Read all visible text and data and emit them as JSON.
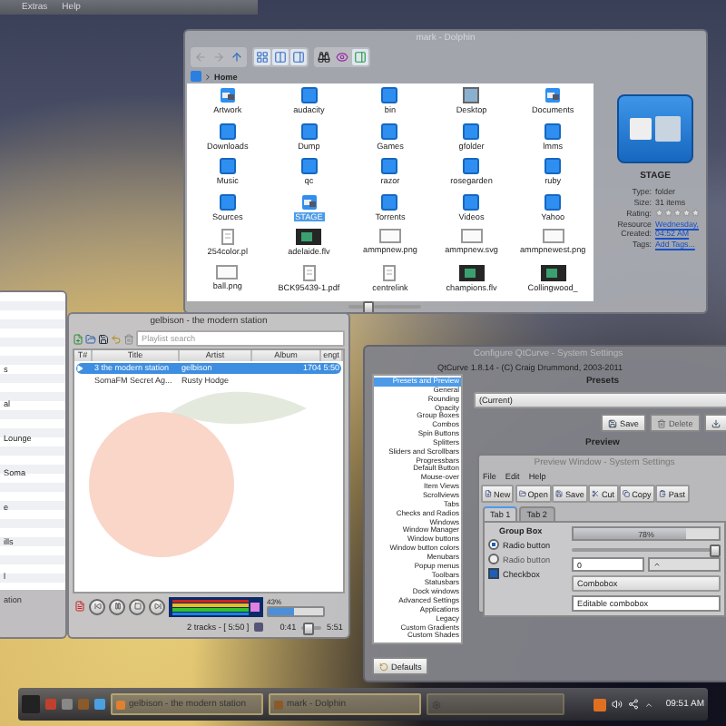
{
  "top_menu": [
    {
      "label": "Extras"
    },
    {
      "label": "Help"
    }
  ],
  "file_manager": {
    "title": "mark - Dolphin",
    "breadcrumb": "Home",
    "files": [
      {
        "name": "Artwork",
        "kind": "image",
        "selected": false
      },
      {
        "name": "audacity",
        "kind": "folder",
        "selected": false
      },
      {
        "name": "bin",
        "kind": "folder",
        "selected": false
      },
      {
        "name": "Desktop",
        "kind": "desktop",
        "selected": false
      },
      {
        "name": "Documents",
        "kind": "image",
        "selected": false
      },
      {
        "name": "Downloads",
        "kind": "folder",
        "selected": false
      },
      {
        "name": "Dump",
        "kind": "folder",
        "selected": false
      },
      {
        "name": "Games",
        "kind": "folder",
        "selected": false
      },
      {
        "name": "gfolder",
        "kind": "folder",
        "selected": false
      },
      {
        "name": "lmms",
        "kind": "folder",
        "selected": false
      },
      {
        "name": "Music",
        "kind": "folder",
        "selected": false
      },
      {
        "name": "qc",
        "kind": "folder",
        "selected": false
      },
      {
        "name": "razor",
        "kind": "folder",
        "selected": false
      },
      {
        "name": "rosegarden",
        "kind": "folder",
        "selected": false
      },
      {
        "name": "ruby",
        "kind": "folder",
        "selected": false
      },
      {
        "name": "Sources",
        "kind": "folder",
        "selected": false
      },
      {
        "name": "STAGE",
        "kind": "image",
        "selected": true
      },
      {
        "name": "Torrents",
        "kind": "folder",
        "selected": false
      },
      {
        "name": "Videos",
        "kind": "folder",
        "selected": false
      },
      {
        "name": "Yahoo",
        "kind": "folder",
        "selected": false
      },
      {
        "name": "254color.pl",
        "kind": "file",
        "selected": false
      },
      {
        "name": "adelaide.flv",
        "kind": "video",
        "selected": false
      },
      {
        "name": "ammpnew.png",
        "kind": "picture",
        "selected": false
      },
      {
        "name": "ammpnew.svg",
        "kind": "picture",
        "selected": false
      },
      {
        "name": "ammpnewest.png",
        "kind": "picture",
        "selected": false
      },
      {
        "name": "ball.png",
        "kind": "picture",
        "selected": false
      },
      {
        "name": "BCK95439-1.pdf",
        "kind": "file",
        "selected": false
      },
      {
        "name": "centrelink",
        "kind": "file",
        "selected": false
      },
      {
        "name": "champions.flv",
        "kind": "video",
        "selected": false
      },
      {
        "name": "Collingwood_",
        "kind": "video",
        "selected": false
      }
    ],
    "zoom": {
      "level": 0.25
    },
    "info": {
      "name": "STAGE",
      "stars": 0,
      "fields": [
        {
          "label": "Type:",
          "value": "folder",
          "kind": "text"
        },
        {
          "label": "Size:",
          "value": "31 items",
          "kind": "text"
        },
        {
          "label": "Rating:",
          "kind": "rating"
        },
        {
          "label": "Resource Created:",
          "value": "Wednesday, 04:52 AM",
          "kind": "link"
        },
        {
          "label": "Tags:",
          "value": "Add Tags...",
          "kind": "link"
        }
      ]
    }
  },
  "library": {
    "items": [
      "s",
      "al",
      "Lounge",
      "Soma",
      "e",
      "ills",
      "l"
    ],
    "footer": "ation"
  },
  "player": {
    "title": "gelbison - the modern station",
    "search": {
      "placeholder": "Playlist search"
    },
    "columns": [
      "T#",
      "Title",
      "Artist",
      "Album",
      "engt"
    ],
    "rows": [
      {
        "title": "3 the modern station",
        "artist": "gelbison",
        "album": "1704",
        "length": "5:50",
        "selected": true,
        "playing": true
      },
      {
        "title": "SomaFM Secret Ag...",
        "artist": "Rusty Hodge",
        "selected": false,
        "playing": false
      }
    ],
    "volume": {
      "reading": "43%",
      "level": 0.45
    },
    "status": "2 tracks - [ 5:50 ]",
    "elapsed": "0:41",
    "position": {
      "level": 0.3
    },
    "total": "5:51"
  },
  "qtcurve": {
    "title": "Configure QtCurve - System Settings",
    "about": "QtCurve 1.8.14 - (C) Craig Drummond, 2003-2011",
    "sections": [
      {
        "label": "Presets and Preview",
        "selected": true
      },
      {
        "label": "General",
        "selected": false
      },
      {
        "label": "Rounding",
        "selected": false
      },
      {
        "label": "Opacity",
        "selected": false
      },
      {
        "label": "Group Boxes",
        "selected": false
      },
      {
        "label": "Combos",
        "selected": false
      },
      {
        "label": "Spin Buttons",
        "selected": false
      },
      {
        "label": "Splitters",
        "selected": false
      },
      {
        "label": "Sliders and Scrollbars",
        "selected": false
      },
      {
        "label": "Progressbars",
        "selected": false
      },
      {
        "label": "Default Button",
        "selected": false
      },
      {
        "label": "Mouse-over",
        "selected": false
      },
      {
        "label": "Item Views",
        "selected": false
      },
      {
        "label": "Scrollviews",
        "selected": false
      },
      {
        "label": "Tabs",
        "selected": false
      },
      {
        "label": "Checks and Radios",
        "selected": false
      },
      {
        "label": "Windows",
        "selected": false
      },
      {
        "label": "Window Manager",
        "selected": false
      },
      {
        "label": "Window buttons",
        "selected": false
      },
      {
        "label": "Window button colors",
        "selected": false
      },
      {
        "label": "Menubars",
        "selected": false
      },
      {
        "label": "Popup menus",
        "selected": false
      },
      {
        "label": "Toolbars",
        "selected": false
      },
      {
        "label": "Statusbars",
        "selected": false
      },
      {
        "label": "Dock windows",
        "selected": false
      },
      {
        "label": "Advanced Settings",
        "selected": false
      },
      {
        "label": "Applications",
        "selected": false
      },
      {
        "label": "Legacy",
        "selected": false
      },
      {
        "label": "Custom Gradients",
        "selected": false
      },
      {
        "label": "Custom Shades",
        "selected": false
      }
    ],
    "presets_label": "Presets",
    "preset": "(Current)",
    "preset_buttons": [
      {
        "label": "Save",
        "disabled": false
      },
      {
        "label": "Delete",
        "disabled": true
      }
    ],
    "preview_label": "Preview",
    "defaults": "Defaults",
    "preview": {
      "title": "Preview Window - System Settings",
      "menu": [
        "File",
        "Edit",
        "Help"
      ],
      "toolbar": [
        {
          "label": "New",
          "kind": "new"
        },
        {
          "label": "Open",
          "kind": "open"
        },
        {
          "label": "Save",
          "kind": "save"
        },
        {
          "label": "Cut",
          "kind": "cut"
        },
        {
          "label": "Copy",
          "kind": "copy"
        },
        {
          "label": "Past",
          "kind": "paste"
        }
      ],
      "tabs": [
        {
          "label": "Tab 1",
          "selected": true
        },
        {
          "label": "Tab 2",
          "selected": false
        }
      ],
      "group_box": "Group Box",
      "radios": [
        {
          "label": "Radio button",
          "selected": true
        },
        {
          "label": "Radio button",
          "selected": false
        }
      ],
      "checkbox": {
        "label": "Checkbox",
        "checked": true
      },
      "progress": {
        "reading": "78%",
        "level": 0.78
      },
      "slider": {
        "level": 0.97
      },
      "spin": "0",
      "combo": "Combobox",
      "editable_combo": "Editable combobox"
    }
  },
  "taskbar": {
    "tasks": [
      {
        "label": "gelbison - the modern station",
        "kind": "player"
      },
      {
        "label": "mark - Dolphin",
        "kind": "files"
      }
    ],
    "clock": "09:51 AM"
  }
}
